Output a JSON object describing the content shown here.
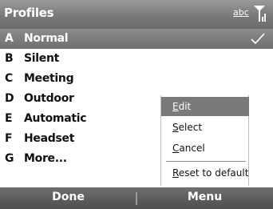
{
  "header": {
    "title": "Profiles",
    "input_mode": "abc",
    "signal_icon": "signal-strength-icon"
  },
  "profiles": [
    {
      "key": "A",
      "label": "Normal",
      "selected": true
    },
    {
      "key": "B",
      "label": "Silent"
    },
    {
      "key": "C",
      "label": "Meeting"
    },
    {
      "key": "D",
      "label": "Outdoor"
    },
    {
      "key": "E",
      "label": "Automatic"
    },
    {
      "key": "F",
      "label": "Headset"
    },
    {
      "key": "G",
      "label": "More..."
    }
  ],
  "context_menu": {
    "items": [
      {
        "first": "E",
        "rest": "dit",
        "active": true
      },
      {
        "first": "S",
        "rest": "elect"
      },
      {
        "first": "C",
        "rest": "ancel"
      },
      {
        "first": "R",
        "rest": "eset to default"
      }
    ]
  },
  "softkeys": {
    "left": "Done",
    "right": "Menu"
  },
  "colors": {
    "titlebar": "#7a7a7a",
    "selection": "#7a7a7a",
    "softkey_bar": "#4e4e4e",
    "text": "#111111"
  }
}
